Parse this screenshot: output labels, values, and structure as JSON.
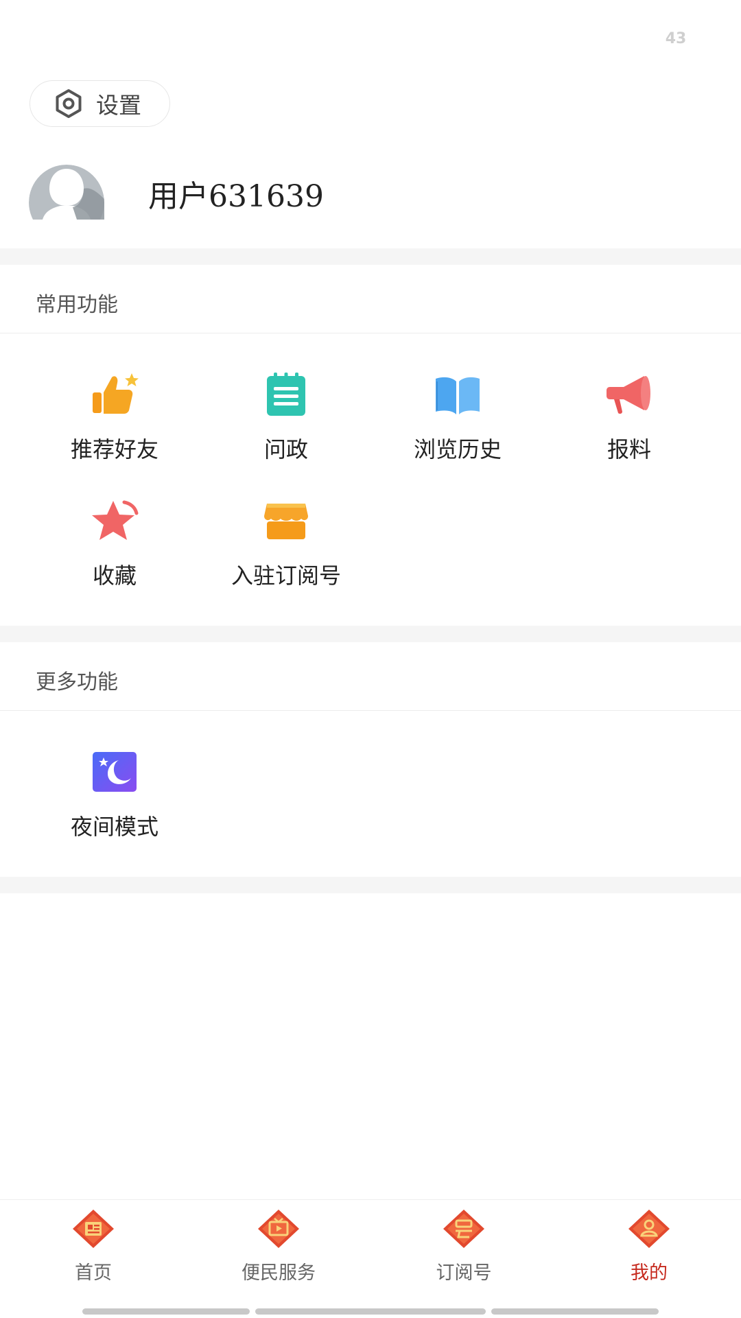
{
  "status": {
    "counter": "43"
  },
  "settings": {
    "label": "设置",
    "icon": "gear-icon"
  },
  "profile": {
    "username": "用户631639",
    "avatar_icon": "default-avatar"
  },
  "common_section": {
    "title": "常用功能",
    "items": [
      {
        "label": "推荐好友",
        "icon": "thumbs-up-star-icon",
        "color": "#f5a623"
      },
      {
        "label": "问政",
        "icon": "notepad-icon",
        "color": "#2ec4b0"
      },
      {
        "label": "浏览历史",
        "icon": "open-book-icon",
        "color": "#4da6f0"
      },
      {
        "label": "报料",
        "icon": "megaphone-icon",
        "color": "#f06565"
      },
      {
        "label": "收藏",
        "icon": "star-icon",
        "color": "#f06565"
      },
      {
        "label": "入驻订阅号",
        "icon": "store-icon",
        "color": "#f7a52a"
      }
    ]
  },
  "more_section": {
    "title": "更多功能",
    "items": [
      {
        "label": "夜间模式",
        "icon": "night-mode-icon",
        "color": "#6a5cf0"
      }
    ]
  },
  "tabbar": {
    "active_color": "#c62a1e",
    "items": [
      {
        "label": "首页",
        "icon": "newspaper-icon",
        "active": false
      },
      {
        "label": "便民服务",
        "icon": "tv-play-icon",
        "active": false
      },
      {
        "label": "订阅号",
        "icon": "subscribe-icon",
        "active": false
      },
      {
        "label": "我的",
        "icon": "user-icon",
        "active": true
      }
    ]
  }
}
